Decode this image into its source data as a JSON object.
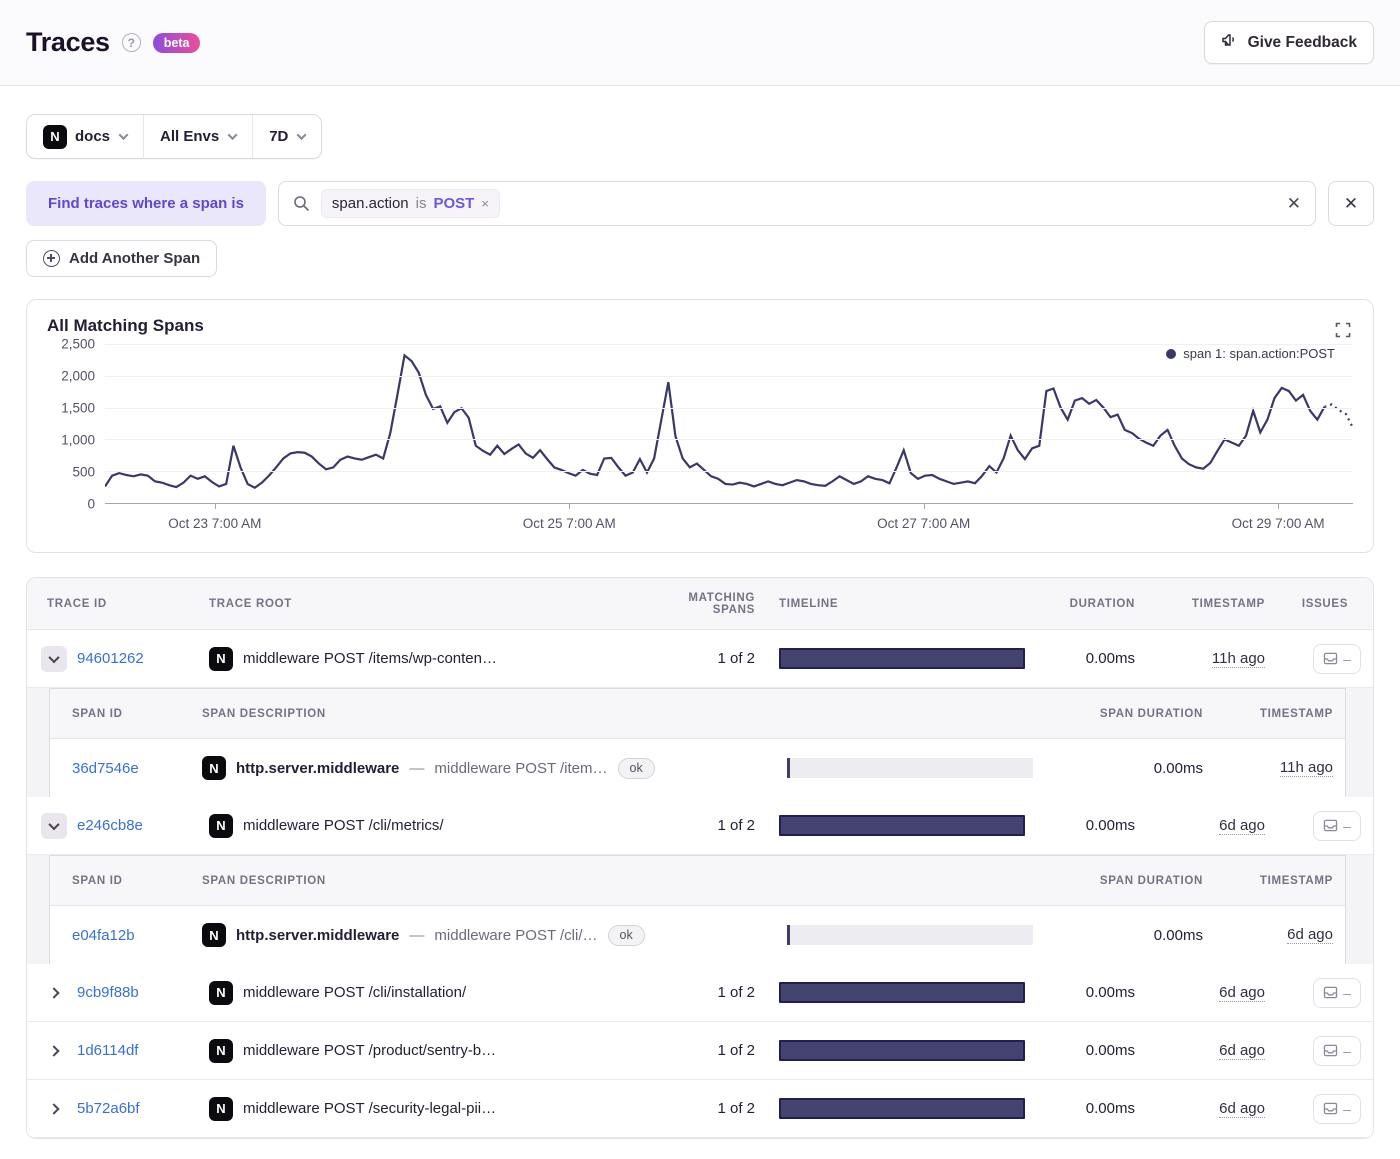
{
  "header": {
    "title": "Traces",
    "beta_label": "beta",
    "feedback_label": "Give Feedback"
  },
  "filters": {
    "project": "docs",
    "environment": "All Envs",
    "period": "7D"
  },
  "span_query": {
    "label": "Find traces where a span is",
    "token": {
      "key": "span.action",
      "op": "is",
      "value": "POST"
    },
    "add_span_label": "Add Another Span"
  },
  "icons": {
    "token_remove_glyph": "×",
    "clear_glyph": "✕",
    "delete_span_glyph": "✕",
    "issues_none_glyph": "–"
  },
  "colors": {
    "accent_purple": "#5b4acb",
    "link_blue": "#3b6fd4",
    "chart_line": "#3a3868",
    "timeline_bar": "#454471",
    "beta_gradient": [
      "#8d4bdb",
      "#ea4f9b"
    ]
  },
  "chart_data": {
    "type": "line",
    "title": "All Matching Spans",
    "legend": "span 1: span.action:POST",
    "ylim": [
      0,
      2500
    ],
    "yticks": [
      "2,500",
      "2,000",
      "1,500",
      "1,000",
      "500",
      "0"
    ],
    "xticks": [
      {
        "label": "Oct 23 7:00 AM",
        "pos": 0.088
      },
      {
        "label": "Oct 25 7:00 AM",
        "pos": 0.372
      },
      {
        "label": "Oct 27 7:00 AM",
        "pos": 0.656
      },
      {
        "label": "Oct 29 7:00 AM",
        "pos": 0.94
      }
    ],
    "dotted_tail": 4,
    "values": [
      260,
      430,
      470,
      440,
      420,
      450,
      430,
      340,
      320,
      280,
      250,
      320,
      430,
      380,
      420,
      330,
      260,
      300,
      900,
      560,
      300,
      240,
      320,
      430,
      560,
      700,
      780,
      800,
      790,
      730,
      620,
      530,
      560,
      680,
      730,
      700,
      680,
      720,
      760,
      700,
      1100,
      1700,
      2320,
      2230,
      2050,
      1700,
      1480,
      1520,
      1260,
      1430,
      1490,
      1340,
      900,
      820,
      760,
      900,
      770,
      850,
      920,
      780,
      710,
      830,
      690,
      560,
      520,
      470,
      430,
      520,
      460,
      440,
      700,
      710,
      560,
      430,
      480,
      690,
      480,
      700,
      1300,
      1900,
      1050,
      700,
      560,
      620,
      520,
      420,
      380,
      300,
      290,
      320,
      300,
      260,
      300,
      340,
      300,
      280,
      320,
      360,
      340,
      300,
      280,
      270,
      340,
      420,
      360,
      300,
      340,
      420,
      380,
      360,
      310,
      560,
      830,
      470,
      380,
      430,
      440,
      380,
      340,
      300,
      320,
      340,
      310,
      430,
      580,
      480,
      700,
      1060,
      830,
      690,
      860,
      900,
      1760,
      1800,
      1500,
      1310,
      1610,
      1650,
      1560,
      1620,
      1500,
      1350,
      1390,
      1150,
      1100,
      1010,
      950,
      900,
      1060,
      1150,
      900,
      700,
      610,
      560,
      540,
      630,
      820,
      1000,
      950,
      900,
      1060,
      1450,
      1110,
      1310,
      1650,
      1810,
      1760,
      1610,
      1700,
      1450,
      1310,
      1510,
      1550,
      1460,
      1400,
      1180
    ]
  },
  "table": {
    "columns": [
      "TRACE ID",
      "TRACE ROOT",
      "MATCHING SPANS",
      "TIMELINE",
      "DURATION",
      "TIMESTAMP",
      "ISSUES"
    ],
    "sub_columns": [
      "SPAN ID",
      "SPAN DESCRIPTION",
      "SPAN DURATION",
      "TIMESTAMP"
    ],
    "rows": [
      {
        "trace_id": "94601262",
        "root": "middleware POST /items/wp-conten…",
        "matching": "1 of 2",
        "duration": "0.00ms",
        "timestamp": "11h ago",
        "spans": [
          {
            "span_id": "36d7546e",
            "op": "http.server.middleware",
            "sep": "—",
            "desc": "middleware POST /item…",
            "status": "ok",
            "duration": "0.00ms",
            "timestamp": "11h ago"
          }
        ]
      },
      {
        "trace_id": "e246cb8e",
        "root": "middleware POST /cli/metrics/",
        "matching": "1 of 2",
        "duration": "0.00ms",
        "timestamp": "6d ago",
        "spans": [
          {
            "span_id": "e04fa12b",
            "op": "http.server.middleware",
            "sep": "—",
            "desc": "middleware POST /cli/…",
            "status": "ok",
            "duration": "0.00ms",
            "timestamp": "6d ago"
          }
        ]
      },
      {
        "trace_id": "9cb9f88b",
        "root": "middleware POST /cli/installation/",
        "matching": "1 of 2",
        "duration": "0.00ms",
        "timestamp": "6d ago",
        "spans": []
      },
      {
        "trace_id": "1d6114df",
        "root": "middleware POST /product/sentry-b…",
        "matching": "1 of 2",
        "duration": "0.00ms",
        "timestamp": "6d ago",
        "spans": []
      },
      {
        "trace_id": "5b72a6bf",
        "root": "middleware POST /security-legal-pii…",
        "matching": "1 of 2",
        "duration": "0.00ms",
        "timestamp": "6d ago",
        "spans": []
      }
    ]
  }
}
